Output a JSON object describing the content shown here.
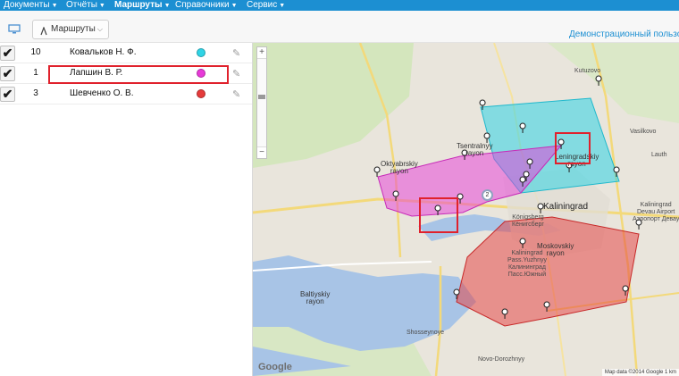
{
  "nav": {
    "items": [
      {
        "label": "Документы",
        "active": false
      },
      {
        "label": "Отчёты",
        "active": false
      },
      {
        "label": "Маршруты",
        "active": true
      },
      {
        "label": "Справочники",
        "active": false
      },
      {
        "label": "Сервис",
        "active": false
      }
    ]
  },
  "toolbar": {
    "routes_label": "Маршруты",
    "user_label": "Демонстрационный пользов"
  },
  "routes": [
    {
      "number": "10",
      "name": "Ковальков Н. Ф.",
      "color": "#2fd4e6",
      "checked": true
    },
    {
      "number": "1",
      "name": "Лапшин В. Р.",
      "color": "#e73ad8",
      "checked": true
    },
    {
      "number": "3",
      "name": "Шевченко О. В.",
      "color": "#e53b3b",
      "checked": true
    }
  ],
  "map": {
    "labels": {
      "oktyabrsky": "Oktyabrskiy\nrayon",
      "tsentralny": "Tsentralnyy\nrayon",
      "leningradsky": "Leningradskiy\nrayon",
      "moskovsky": "Moskovskiy\nrayon",
      "kaliningrad": "Kaliningrad",
      "baltiysky": "Baltiyskiy\nrayon",
      "pass_yuzhny": "Kaliningrad\nPass.Yuzhnyy\nКалининград\nПасс.Южный",
      "konigsberg": "Königsberg\nКёнигсберг",
      "devau": "Kaliningrad\nDevau Airport\nАэропорт Девау",
      "kutuzovo": "Kutuzovo",
      "vasilkovo": "Vasilkovo",
      "lauth": "Lauth",
      "shosseynoye": "Shosseynoye",
      "novo_dorozhny": "Novo-Dorozhnyy"
    },
    "cluster_count": "2",
    "attribution": "Map data ©2014 Google   1 km",
    "google_logo": "Google",
    "polygon_colors": {
      "cyan": "#2fd4e6",
      "magenta": "#e73ad8",
      "red": "#e53b3b"
    }
  }
}
